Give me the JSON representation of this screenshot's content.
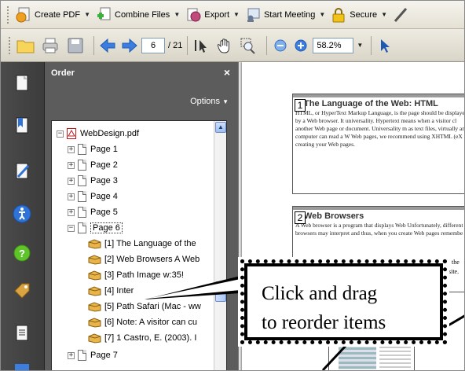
{
  "toolbar1": {
    "create_pdf": "Create PDF",
    "combine_files": "Combine Files",
    "export": "Export",
    "start_meeting": "Start Meeting",
    "secure": "Secure"
  },
  "toolbar2": {
    "page_current": "6",
    "page_total": "/ 21",
    "zoom": "58.2%"
  },
  "panel": {
    "title": "Order",
    "close": "×",
    "options": "Options",
    "tree": {
      "root": "WebDesign.pdf",
      "pages": [
        "Page 1",
        "Page 2",
        "Page 3",
        "Page 4",
        "Page 5",
        "Page 6"
      ],
      "children": [
        "[1] The Language of the",
        "[2] Web Browsers A Web",
        "[3] Path Image   w:35!",
        "[4] Inter",
        "[5] Path Safari (Mac - ww",
        "[6] Note: A visitor can cu",
        "[7] 1 Castro, E. (2003). I"
      ],
      "after": "Page 7"
    }
  },
  "document": {
    "slide1": {
      "number": "1",
      "heading": "The Language of the Web: HTML",
      "body": "HTML, or HyperText Markup Language, is the page should be displayed by a Web browser. It universality. Hypertext means when a visitor cl another Web page or document. Universality m as text files, virtually any computer can read a W Web pages, we recommend using XHTML (eX creating your Web pages."
    },
    "slide2": {
      "number": "2",
      "heading": "Web Browsers",
      "body": "A Web browser is a program that displays Web Unfortunately, different browsers may interpret and thus, when you create Web pages remembe"
    },
    "frag1": "the",
    "frag2": "site.",
    "frag3": "te"
  },
  "callout": {
    "line1": "Click and drag",
    "line2": "to reorder items"
  }
}
